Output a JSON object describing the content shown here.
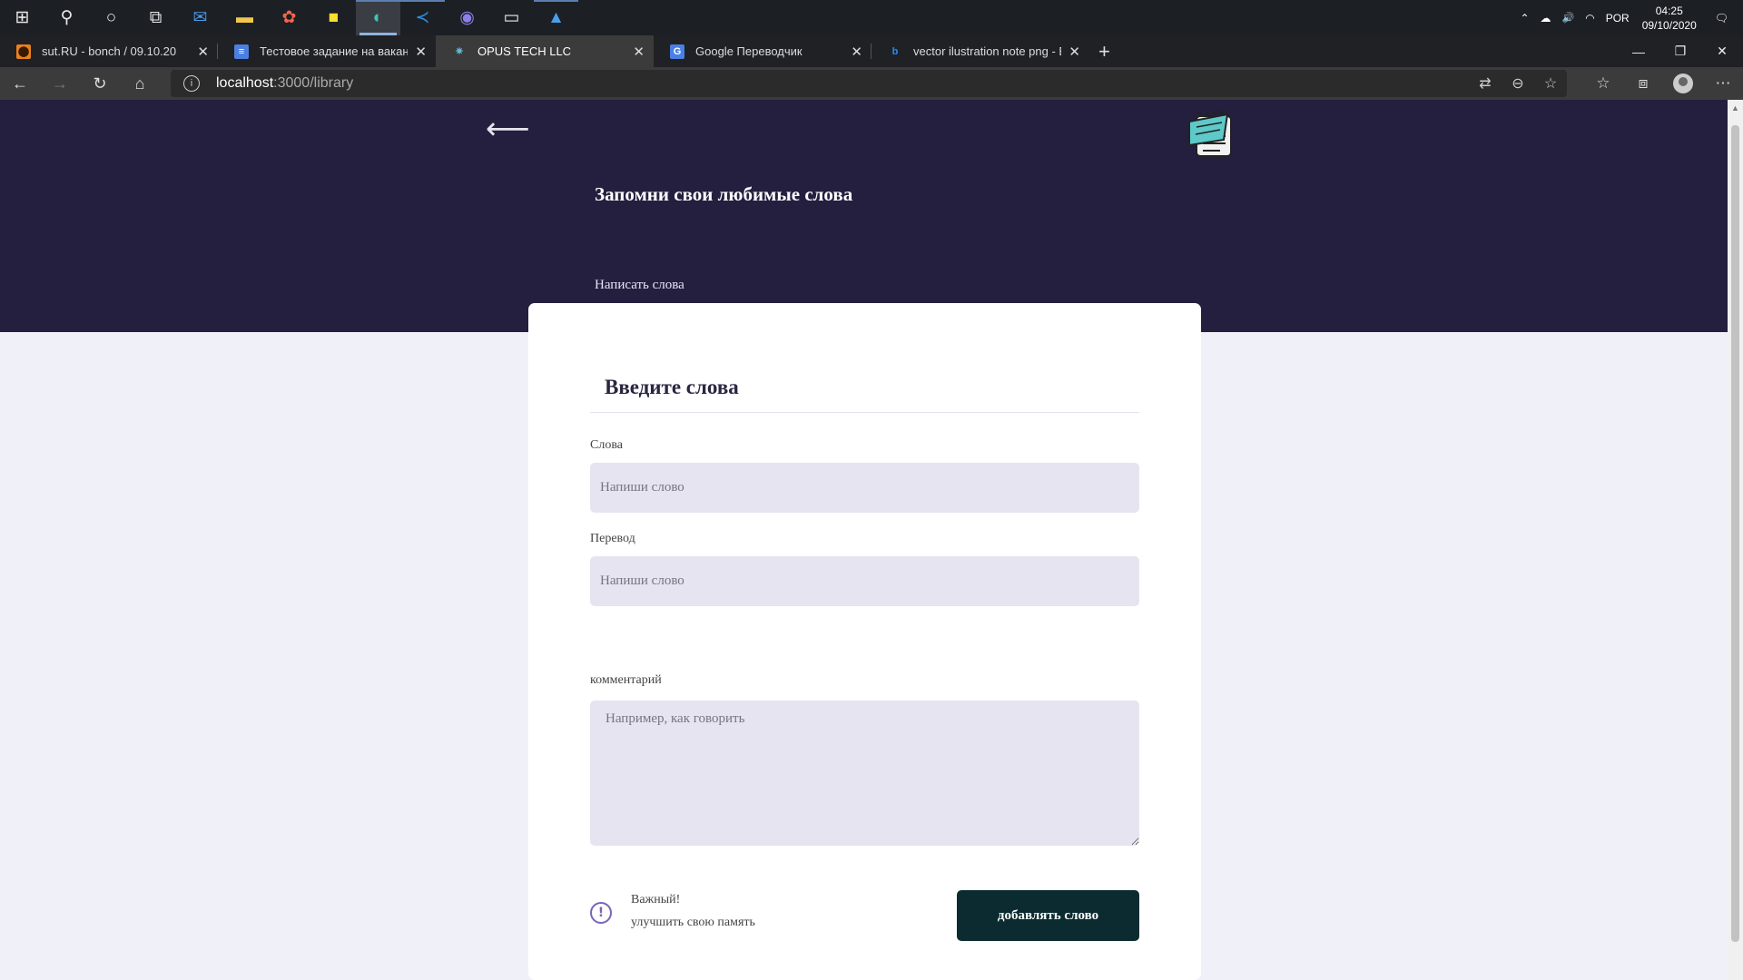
{
  "taskbar": {
    "apps": [
      {
        "name": "start",
        "glyph": "⊞"
      },
      {
        "name": "search",
        "glyph": "⚲"
      },
      {
        "name": "cortana",
        "glyph": "○"
      },
      {
        "name": "task-view",
        "glyph": "⧉"
      },
      {
        "name": "mail",
        "glyph": "✉"
      },
      {
        "name": "file-explorer",
        "glyph": "▬"
      },
      {
        "name": "figma",
        "glyph": "✿"
      },
      {
        "name": "sticky-notes",
        "glyph": "■"
      },
      {
        "name": "edge",
        "glyph": "◐"
      },
      {
        "name": "vscode",
        "glyph": "≺"
      },
      {
        "name": "app-circle",
        "glyph": "◉"
      },
      {
        "name": "terminal",
        "glyph": "▭"
      },
      {
        "name": "photos",
        "glyph": "▲"
      }
    ],
    "tray": {
      "chevron": "⌃",
      "cloud": "☁",
      "volume": "🔊",
      "wifi": "◠",
      "language": "POR",
      "time": "04:25",
      "date": "09/10/2020",
      "notifications": "🗨"
    }
  },
  "browser": {
    "tabs": [
      {
        "title": "sut.RU - bonch / 09.10.20",
        "favicon_color": "#e8811f",
        "favicon_glyph": "⬤",
        "active": false
      },
      {
        "title": "Тестовое задание на вакансию",
        "favicon_color": "#4c7fe0",
        "favicon_glyph": "≡",
        "active": false
      },
      {
        "title": "OPUS TECH LLC",
        "favicon_color": "#61b8d4",
        "favicon_glyph": "✷",
        "active": true
      },
      {
        "title": "Google Переводчик",
        "favicon_color": "#4a7fe6",
        "favicon_glyph": "G",
        "active": false
      },
      {
        "title": "vector ilustration note png - Bing",
        "favicon_color": "#1e6fd6",
        "favicon_glyph": "b",
        "active": false
      }
    ],
    "new_tab": "+",
    "close_glyph": "✕",
    "window": {
      "minimize": "—",
      "restore": "❐",
      "close": "✕"
    },
    "nav": {
      "back": "←",
      "forward": "→",
      "reload": "↻",
      "home": "⌂"
    },
    "url": {
      "host": "localhost",
      "path": ":3000/library",
      "info_glyph": "i"
    },
    "url_tools": {
      "translate": "⇄",
      "zoom": "⊖",
      "favorite": "☆"
    },
    "toolbar": {
      "favorites": "☆",
      "collections": "⧈",
      "more": "⋯"
    }
  },
  "hero": {
    "back_glyph": "⟵",
    "title": "Запомни свои любимые слова",
    "link": "Написать слова"
  },
  "form": {
    "title": "Введите слова",
    "word_label": "Слова",
    "word_placeholder": "Напиши слово",
    "translation_label": "Перевод",
    "translation_placeholder": "Напиши слово",
    "comment_label": "комментарий",
    "comment_placeholder": "Например, как говорить",
    "tip_glyph": "!",
    "tip_title": "Важный!",
    "tip_text": "улучшить свою память",
    "submit_label": "добавлять слово"
  },
  "colors": {
    "hero_bg": "#241f3f",
    "page_bg": "#f0f0f8",
    "input_bg": "#e6e4f0",
    "button_bg": "#0b2b30",
    "accent": "#7b63b8"
  }
}
